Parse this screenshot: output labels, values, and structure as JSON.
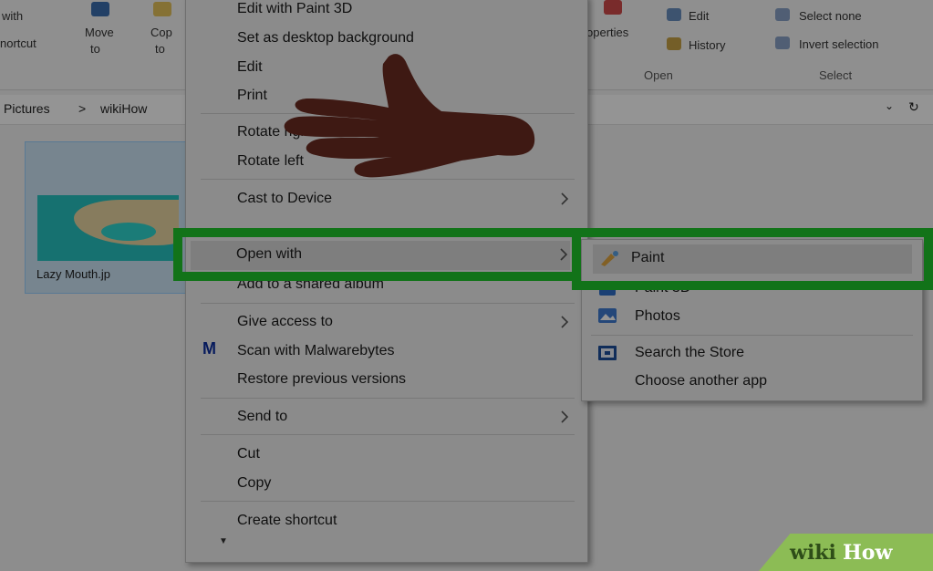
{
  "ribbon": {
    "left_item_1": "with",
    "left_item_2": "nortcut",
    "move_to": "Move",
    "move_to_2": "to",
    "copy_to": "Cop",
    "copy_to_2": "to",
    "properties": "operties",
    "edit": "Edit",
    "history": "History",
    "select_none": "Select none",
    "invert_selection": "Invert selection",
    "group_open": "Open",
    "group_select": "Select"
  },
  "address": {
    "crumb_1": "Pictures",
    "separator": ">",
    "crumb_2": "wikiHow"
  },
  "thumbnail": {
    "caption": "Lazy Mouth.jp"
  },
  "context_menu": {
    "items": [
      {
        "label": "Edit with Paint 3D"
      },
      {
        "label": "Set as desktop background"
      },
      {
        "label": "Edit"
      },
      {
        "label": "Print"
      },
      {
        "label": "Rotate right"
      },
      {
        "label": "Rotate left"
      },
      {
        "label": "Cast to Device"
      },
      {
        "label": "Open with"
      },
      {
        "label": "Add to a shared album"
      },
      {
        "label": "Give access to"
      },
      {
        "label": "Scan with Malwarebytes"
      },
      {
        "label": "Restore previous versions"
      },
      {
        "label": "Send to"
      },
      {
        "label": "Cut"
      },
      {
        "label": "Copy"
      },
      {
        "label": "Create shortcut"
      }
    ],
    "malwarebytes_icon": "M",
    "more": "▼"
  },
  "submenu": {
    "items": [
      {
        "label": "Paint",
        "icon": "paint-icon"
      },
      {
        "label": "Paint 3D",
        "icon": "paint3d-icon"
      },
      {
        "label": "Photos",
        "icon": "photos-icon"
      },
      {
        "label": "Search the Store",
        "icon": "store-icon"
      },
      {
        "label": "Choose another app"
      }
    ]
  },
  "watermark": {
    "wiki": "wiki",
    "how": "How"
  },
  "colors": {
    "highlight": "#1fc72c",
    "menu_bg": "#f0f0f0",
    "watermark": "#8cbc55"
  }
}
